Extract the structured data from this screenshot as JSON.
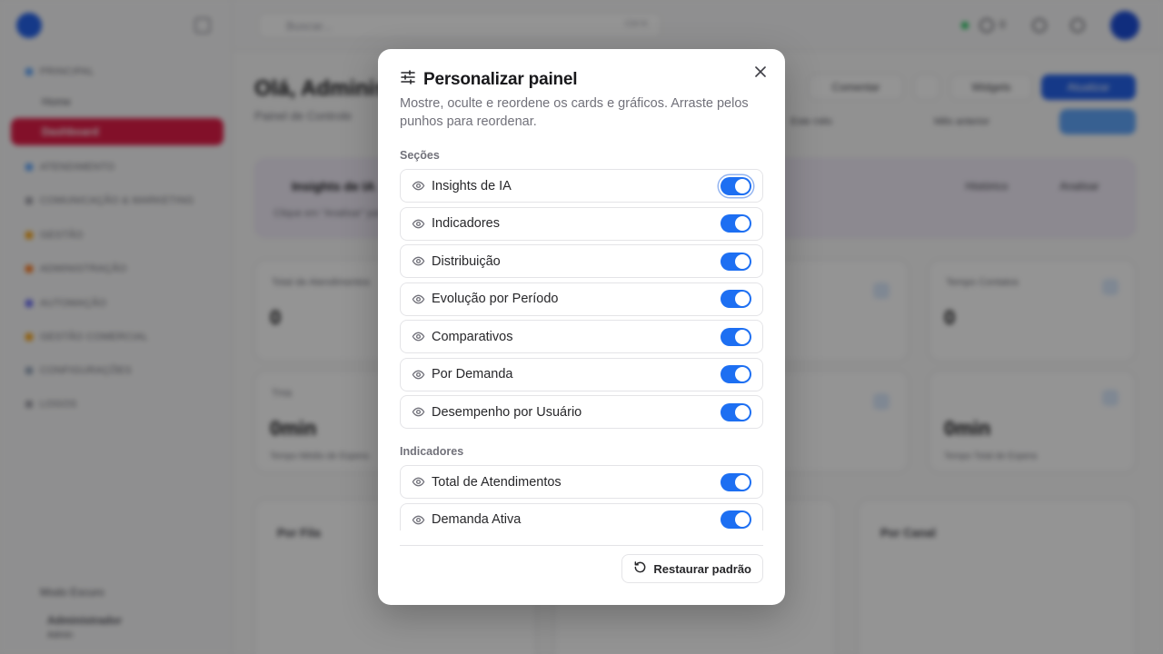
{
  "background": {
    "search_placeholder": "Buscar...",
    "search_shortcut": "Ctrl K",
    "topbar_counter": "0",
    "sidebar": {
      "groups": [
        {
          "label": "PRINCIPAL"
        },
        {
          "label": "ATENDIMENTO"
        },
        {
          "label": "COMUNICAÇÃO & MARKETING"
        },
        {
          "label": "GESTÃO"
        },
        {
          "label": "ADMINISTRAÇÃO"
        },
        {
          "label": "AUTOMAÇÃO"
        },
        {
          "label": "GESTÃO COMERCIAL"
        },
        {
          "label": "CONFIGURAÇÕES"
        },
        {
          "label": "LOGOS"
        }
      ],
      "items": [
        {
          "label": "Home"
        },
        {
          "label": "Dashboard"
        }
      ],
      "footer_mode": "Modo Escuro",
      "footer_user": "Administrador",
      "footer_role": "Admin"
    },
    "page_title": "Olá, Administrador",
    "page_subtitle": "Painel de Controle",
    "buttons": {
      "comments": "Comentar",
      "widgets": "Widgets",
      "primary": "Atualizar"
    },
    "filters": {
      "period": "Este mês",
      "compare": "Mês anterior"
    },
    "insights": {
      "title": "Insights de IA",
      "hint": "Clique em \"Analisar\" para gerar insights",
      "history": "Histórico",
      "analyze": "Analisar"
    },
    "cards": [
      {
        "label": "Total de Atendimentos",
        "value": "0",
        "caption": ""
      },
      {
        "label": "Tempo Médio",
        "value": "0min",
        "caption": "Tempo Médio de Espera"
      },
      {
        "label": "Tempo Contatos",
        "value": "0",
        "caption": ""
      },
      {
        "label": "Tma",
        "value": "0min",
        "caption": "Tempo Total de Espera"
      }
    ],
    "panels": [
      {
        "label": "Por Fila"
      },
      {
        "label": "Por Canal"
      }
    ]
  },
  "modal": {
    "title": "Personalizar painel",
    "description": "Mostre, oculte e reordene os cards e gráficos. Arraste pelos punhos para reordenar.",
    "sections_label": "Seções",
    "sections": [
      {
        "label": "Insights de IA",
        "enabled": true
      },
      {
        "label": "Indicadores",
        "enabled": true
      },
      {
        "label": "Distribuição",
        "enabled": true
      },
      {
        "label": "Evolução por Período",
        "enabled": true
      },
      {
        "label": "Comparativos",
        "enabled": true
      },
      {
        "label": "Por Demanda",
        "enabled": true
      },
      {
        "label": "Desempenho por Usuário",
        "enabled": true
      }
    ],
    "indicators_label": "Indicadores",
    "indicators": [
      {
        "label": "Total de Atendimentos",
        "enabled": true
      },
      {
        "label": "Demanda Ativa",
        "enabled": true
      }
    ],
    "restore_label": "Restaurar padrão"
  },
  "colors": {
    "toggle_on": "#1d6ff2",
    "sidebar_active": "#e11d48",
    "primary": "#2563eb"
  }
}
